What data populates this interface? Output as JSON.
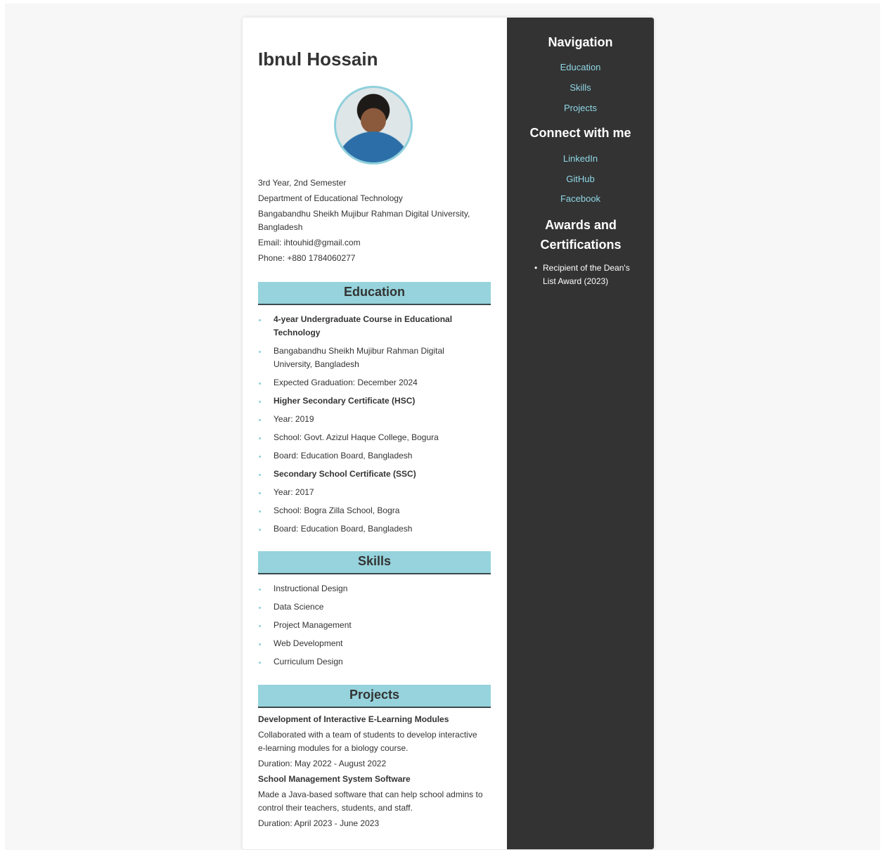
{
  "profile": {
    "name": "Ibnul Hossain",
    "info": [
      "3rd Year, 2nd Semester",
      "Department of Educational Technology",
      "Bangabandhu Sheikh Mujibur Rahman Digital University, Bangladesh",
      "Email: ihtouhid@gmail.com",
      "Phone: +880 1784060277"
    ]
  },
  "education": {
    "heading": "Education",
    "items": [
      "4-year Undergraduate Course in Educational Technology",
      "Bangabandhu Sheikh Mujibur Rahman Digital University, Bangladesh",
      "Expected Graduation: December 2024",
      "Higher Secondary Certificate (HSC)",
      "Year: 2019",
      "School: Govt. Azizul Haque College, Bogura",
      "Board: Education Board, Bangladesh",
      "Secondary School Certificate (SSC)",
      "Year: 2017",
      "School: Bogra Zilla School, Bogra",
      "Board: Education Board, Bangladesh"
    ]
  },
  "skills": {
    "heading": "Skills",
    "items": [
      "Instructional Design",
      "Data Science",
      "Project Management",
      "Web Development",
      "Curriculum Design"
    ]
  },
  "projects": {
    "heading": "Projects",
    "items": [
      {
        "title": "Development of Interactive E-Learning Modules",
        "description": "Collaborated with a team of students to develop interactive e-learning modules for a biology course.",
        "duration": "Duration: May 2022 - August 2022"
      },
      {
        "title": "School Management System Software",
        "description": "Made a Java-based software that can help school admins to control their teachers, students, and staff.",
        "duration": "Duration: April 2023 - June 2023"
      }
    ]
  },
  "sidebar": {
    "nav_heading": "Navigation",
    "nav_links": [
      "Education",
      "Skills",
      "Projects"
    ],
    "connect_heading": "Connect with me",
    "connect_links": [
      "LinkedIn",
      "GitHub",
      "Facebook"
    ],
    "awards_heading": "Awards and Certifications",
    "awards": [
      "Recipient of the Dean's List Award (2023)"
    ]
  },
  "colors": {
    "accent": "#96d3dc",
    "sidebar_bg": "#333333",
    "link": "#8fd7e6"
  }
}
